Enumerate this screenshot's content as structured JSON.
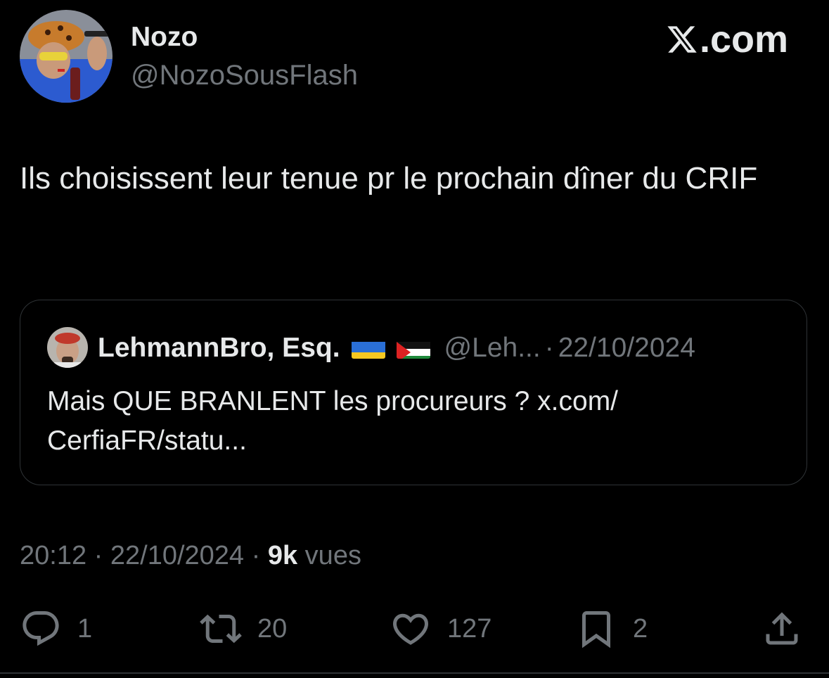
{
  "author": {
    "display_name": "Nozo",
    "handle": "@NozoSousFlash",
    "avatar": "profile-photo"
  },
  "brand": {
    "text": ".com",
    "icon": "x-logo-icon"
  },
  "tweet": {
    "text": "Ils choisissent leur tenue pr le prochain dîner du CRIF"
  },
  "quoted_tweet": {
    "display_name": "LehmannBro, Esq.",
    "flags": [
      "ukraine-flag",
      "palestine-flag"
    ],
    "handle": "@Leh...",
    "separator": "·",
    "date": "22/10/2024",
    "text": "Mais QUE BRANLENT les procureurs ? x.com/ CerfiaFR/statu..."
  },
  "meta": {
    "time": "20:12",
    "sep1": " · ",
    "date": "22/10/2024",
    "sep2": " · ",
    "views_count": "9k",
    "views_label": " vues"
  },
  "actions": {
    "replies": "1",
    "reposts": "20",
    "likes": "127",
    "bookmarks": "2"
  },
  "colors": {
    "background": "#000000",
    "primary_text": "#e7e9ea",
    "secondary_text": "#71767b",
    "border": "#2f3336"
  }
}
